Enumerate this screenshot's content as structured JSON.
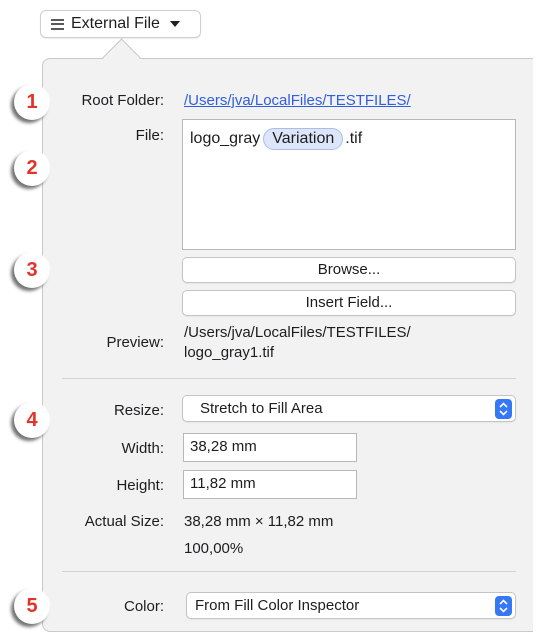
{
  "source_menu": {
    "label": "External File",
    "icon": "list-icon"
  },
  "markers": [
    "1",
    "2",
    "3",
    "4",
    "5"
  ],
  "labels": {
    "root_folder": "Root Folder:",
    "file": "File:",
    "preview": "Preview:",
    "resize": "Resize:",
    "width": "Width:",
    "height": "Height:",
    "actual_size": "Actual Size:",
    "color": "Color:"
  },
  "root_folder": {
    "path": "/Users/jva/LocalFiles/TESTFILES/"
  },
  "file_field": {
    "prefix": "logo_gray",
    "token": "Variation",
    "suffix": ".tif"
  },
  "buttons": {
    "browse": "Browse...",
    "insert_field": "Insert Field..."
  },
  "preview": {
    "line1": "/Users/jva/LocalFiles/TESTFILES/",
    "line2": "logo_gray1.tif"
  },
  "resize": {
    "selected": "Stretch to Fill Area"
  },
  "width": {
    "value": "38,28 mm"
  },
  "height": {
    "value": "11,82 mm"
  },
  "actual_size": {
    "dimensions": "38,28 mm × 11,82 mm",
    "percent": "100,00%"
  },
  "color": {
    "selected": "From Fill Color Inspector"
  },
  "colors": {
    "accent": "#3478f6",
    "marker": "#e4332a",
    "link": "#2f5ee0",
    "token_bg": "#dde6f8"
  }
}
